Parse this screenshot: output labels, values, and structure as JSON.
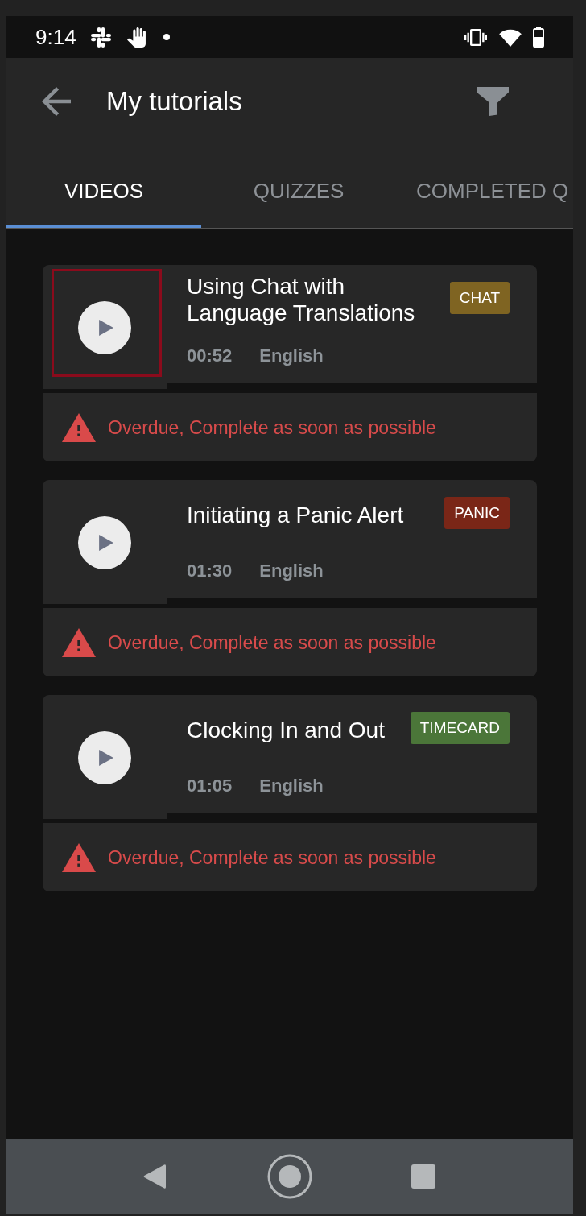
{
  "status_bar": {
    "time": "9:14"
  },
  "app_bar": {
    "title": "My tutorials"
  },
  "tabs": [
    {
      "label": "VIDEOS",
      "selected": true
    },
    {
      "label": "QUIZZES",
      "selected": false
    },
    {
      "label": "COMPLETED Q",
      "selected": false
    }
  ],
  "videos": [
    {
      "title": "Using Chat with Language Translations",
      "tag": {
        "label": "CHAT",
        "color": "#7f6422"
      },
      "duration": "00:52",
      "language": "English",
      "focused": true,
      "alert": "Overdue, Complete as soon as possible"
    },
    {
      "title": "Initiating a Panic Alert",
      "tag": {
        "label": "PANIC",
        "color": "#7a2617"
      },
      "duration": "01:30",
      "language": "English",
      "focused": false,
      "alert": "Overdue, Complete as soon as possible"
    },
    {
      "title": "Clocking In and Out",
      "tag": {
        "label": "TIMECARD",
        "color": "#4b7639"
      },
      "duration": "01:05",
      "language": "English",
      "focused": false,
      "alert": "Overdue, Complete as soon as possible"
    }
  ]
}
